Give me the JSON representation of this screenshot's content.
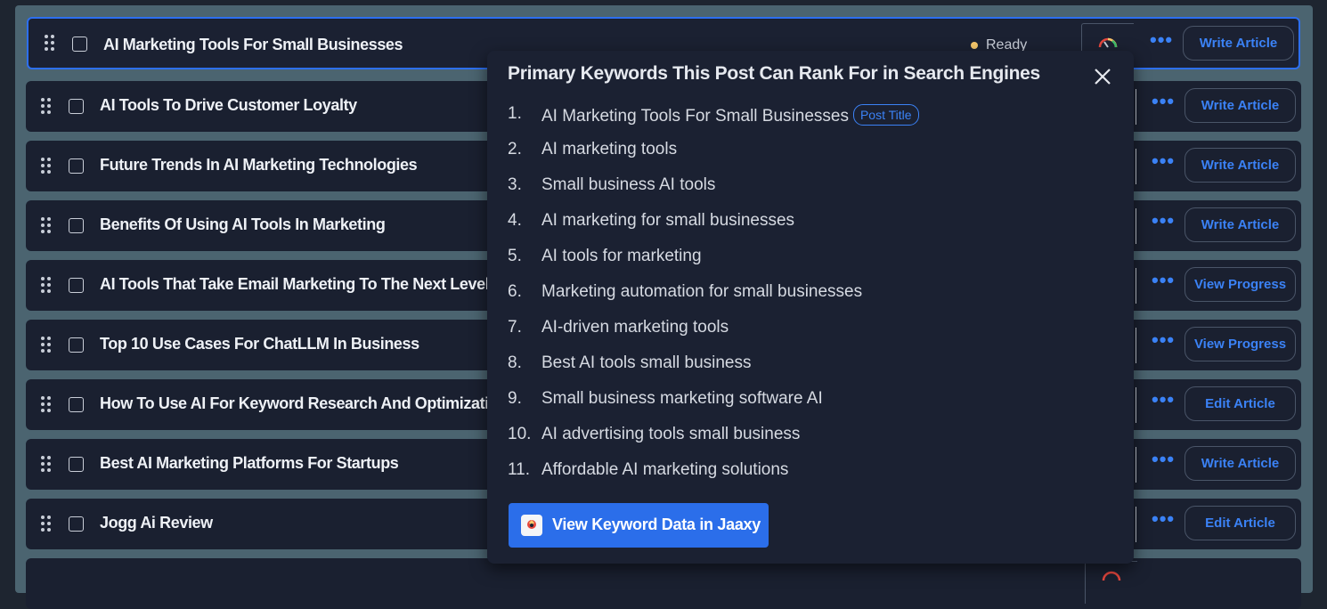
{
  "rows": [
    {
      "title": "AI Marketing Tools For Small Businesses",
      "status": "Ready",
      "action": "Write Article",
      "selected": true
    },
    {
      "title": "AI Tools To Drive Customer Loyalty",
      "action": "Write Article"
    },
    {
      "title": "Future Trends In AI Marketing Technologies",
      "action": "Write Article"
    },
    {
      "title": "Benefits Of Using AI Tools In Marketing",
      "action": "Write Article"
    },
    {
      "title": "AI Tools That Take Email Marketing To The Next Level",
      "action": "View Progress"
    },
    {
      "title": "Top 10 Use Cases For ChatLLM In Business",
      "action": "View Progress"
    },
    {
      "title": "How To Use AI For Keyword Research And Optimization",
      "action": "Edit Article"
    },
    {
      "title": "Best AI Marketing Platforms For Startups",
      "action": "Write Article"
    },
    {
      "title": "Jogg Ai Review",
      "action": "Edit Article"
    }
  ],
  "popup": {
    "title": "Primary Keywords This Post Can Rank For in Search Engines",
    "badge": "Post Title",
    "keywords": [
      {
        "num": "1.",
        "text": "AI Marketing Tools For Small Businesses"
      },
      {
        "num": "2.",
        "text": "AI marketing tools"
      },
      {
        "num": "3.",
        "text": "Small business AI tools"
      },
      {
        "num": "4.",
        "text": "AI marketing for small businesses"
      },
      {
        "num": "5.",
        "text": "AI tools for marketing"
      },
      {
        "num": "6.",
        "text": "Marketing automation for small businesses"
      },
      {
        "num": "7.",
        "text": "AI-driven marketing tools"
      },
      {
        "num": "8.",
        "text": "Best AI tools small business"
      },
      {
        "num": "9.",
        "text": "Small business marketing software AI"
      },
      {
        "num": "10.",
        "text": "AI advertising tools small business"
      },
      {
        "num": "11.",
        "text": "Affordable AI marketing solutions"
      }
    ],
    "cta_label": "View Keyword Data in Jaaxy"
  },
  "icons": {
    "drag": "drag-handle-icon",
    "more": "more-options-icon",
    "close": "close-icon",
    "gauge": "seo-gauge-icon",
    "jaaxy": "jaaxy-logo-icon"
  },
  "colors": {
    "accent": "#3b82f6",
    "button": "#2b6eea",
    "row_bg": "#1a2030",
    "frame": "#4b6470",
    "status_ready": "#f6c86b"
  }
}
